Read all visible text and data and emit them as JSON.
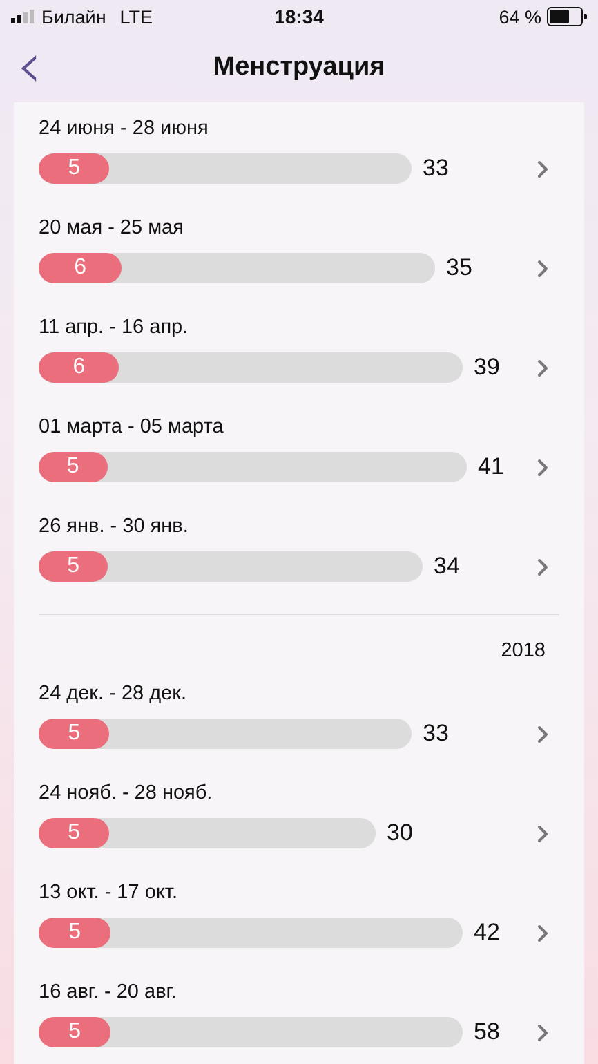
{
  "status_bar": {
    "carrier": "Билайн",
    "network": "LTE",
    "time": "18:34",
    "battery": "64 %"
  },
  "header": {
    "back": "‹",
    "title": "Менструация"
  },
  "groups": [
    {
      "periods": [
        {
          "dates": "24 июня - 28 июня",
          "period": {
            "value": "5",
            "level": 0.19
          },
          "cycle": "33"
        },
        {
          "dates": "20 мая - 25 мая",
          "period": {
            "value": "6",
            "level": 0.21
          },
          "cycle": "35"
        },
        {
          "dates": "11 апр. - 16 апр.",
          "period": {
            "value": "6",
            "level": 0.19
          },
          "cycle": "39"
        },
        {
          "dates": "01 марта - 05 марта",
          "period": {
            "value": "5",
            "level": 0.16
          },
          "cycle": "41"
        },
        {
          "dates": "26 янв. - 30 янв.",
          "period": {
            "value": "5",
            "level": 0.18
          },
          "cycle": "34"
        }
      ]
    },
    {
      "year": "2018",
      "periods": [
        {
          "dates": "24 дек. - 28 дек.",
          "period": {
            "value": "5",
            "level": 0.19
          },
          "cycle": "33"
        },
        {
          "dates": "24 нояб. - 28 нояб.",
          "period": {
            "value": "5",
            "level": 0.21
          },
          "cycle": "30"
        },
        {
          "dates": "13 окт. - 17 окт.",
          "period": {
            "value": "5",
            "level": 0.17
          },
          "cycle": "42"
        },
        {
          "dates": "16 авг. - 20 авг.",
          "period": {
            "value": "5",
            "level": 0.17
          },
          "cycle": "58"
        }
      ]
    }
  ]
}
